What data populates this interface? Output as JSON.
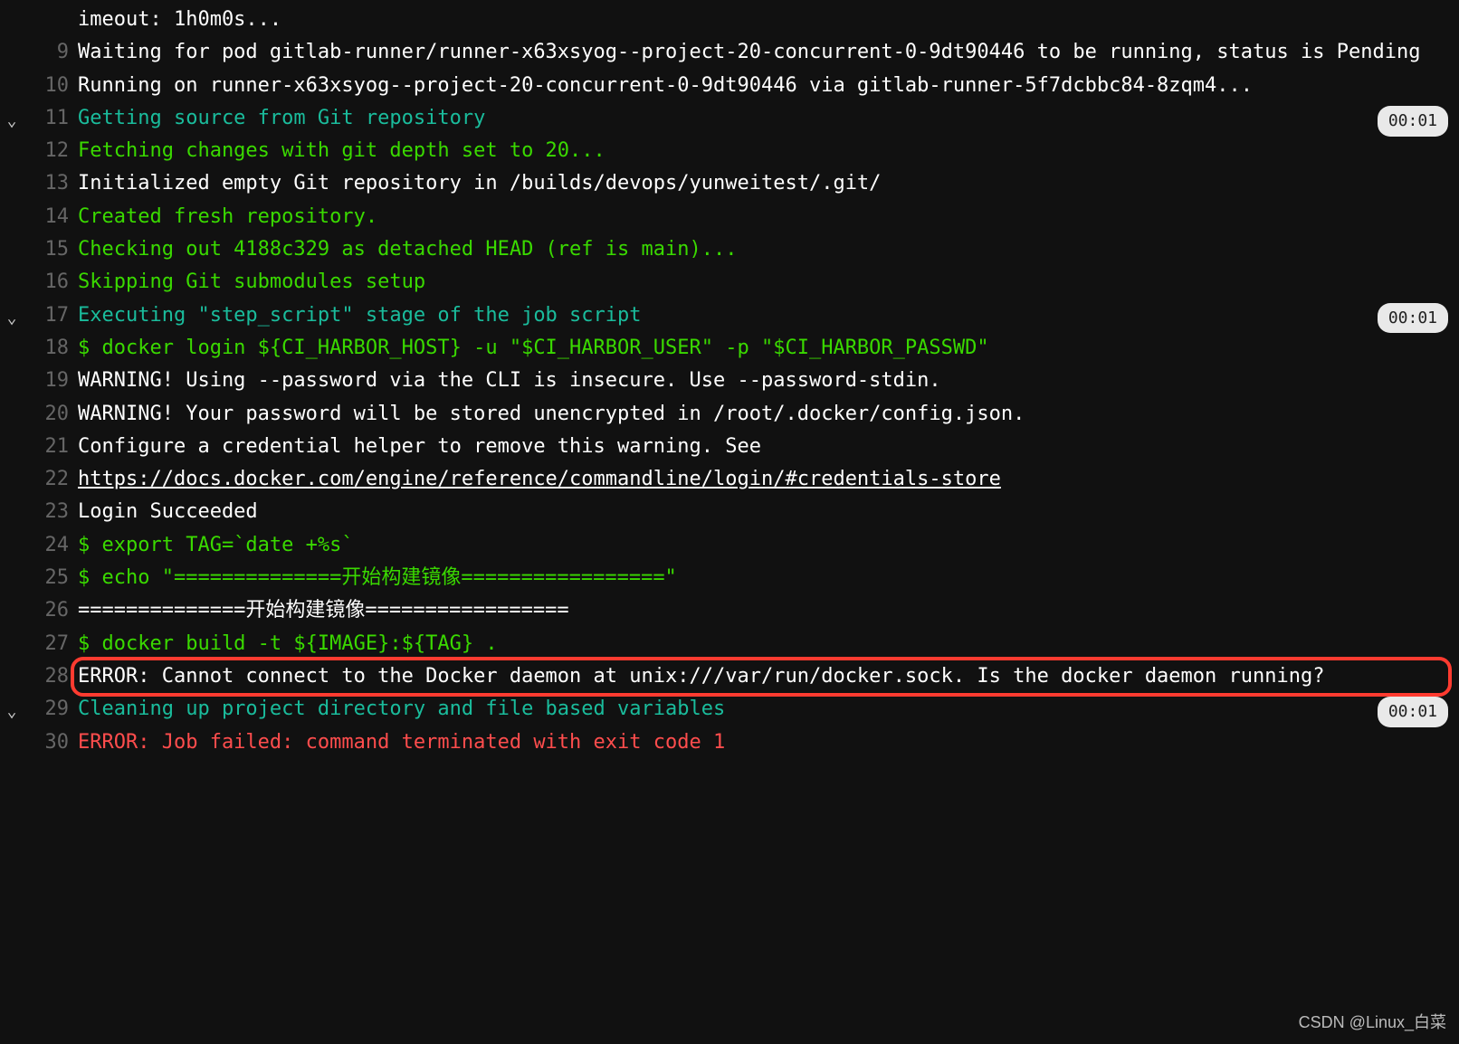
{
  "durations": {
    "git_section": "00:01",
    "script_section": "00:01",
    "cleanup_section": "00:01"
  },
  "watermark": "CSDN @Linux_白菜",
  "lines": [
    {
      "num": "",
      "collapsible": false,
      "color": "white",
      "text": "imeout: 1h0m0s...",
      "duration": null,
      "link": false
    },
    {
      "num": "9",
      "collapsible": false,
      "color": "white",
      "text": "Waiting for pod gitlab-runner/runner-x63xsyog--project-20-concurrent-0-9dt90446 to be running, status is Pending",
      "duration": null,
      "link": false
    },
    {
      "num": "10",
      "collapsible": false,
      "color": "white",
      "text": "Running on runner-x63xsyog--project-20-concurrent-0-9dt90446 via gitlab-runner-5f7dcbbc84-8zqm4...",
      "duration": null,
      "link": false
    },
    {
      "num": "11",
      "collapsible": true,
      "color": "teal",
      "text": "Getting source from Git repository",
      "duration": "git_section",
      "link": false
    },
    {
      "num": "12",
      "collapsible": false,
      "color": "green",
      "text": "Fetching changes with git depth set to 20...",
      "duration": null,
      "link": false
    },
    {
      "num": "13",
      "collapsible": false,
      "color": "white",
      "text": "Initialized empty Git repository in /builds/devops/yunweitest/.git/",
      "duration": null,
      "link": false
    },
    {
      "num": "14",
      "collapsible": false,
      "color": "green",
      "text": "Created fresh repository.",
      "duration": null,
      "link": false
    },
    {
      "num": "15",
      "collapsible": false,
      "color": "green",
      "text": "Checking out 4188c329 as detached HEAD (ref is main)...",
      "duration": null,
      "link": false
    },
    {
      "num": "16",
      "collapsible": false,
      "color": "green",
      "text": "Skipping Git submodules setup",
      "duration": null,
      "link": false
    },
    {
      "num": "17",
      "collapsible": true,
      "color": "teal",
      "text": "Executing \"step_script\" stage of the job script",
      "duration": "script_section",
      "link": false
    },
    {
      "num": "18",
      "collapsible": false,
      "color": "green",
      "text": "$ docker login ${CI_HARBOR_HOST} -u \"$CI_HARBOR_USER\" -p \"$CI_HARBOR_PASSWD\"",
      "duration": null,
      "link": false
    },
    {
      "num": "19",
      "collapsible": false,
      "color": "white",
      "text": "WARNING! Using --password via the CLI is insecure. Use --password-stdin.",
      "duration": null,
      "link": false
    },
    {
      "num": "20",
      "collapsible": false,
      "color": "white",
      "text": "WARNING! Your password will be stored unencrypted in /root/.docker/config.json.",
      "duration": null,
      "link": false
    },
    {
      "num": "21",
      "collapsible": false,
      "color": "white",
      "text": "Configure a credential helper to remove this warning. See",
      "duration": null,
      "link": false
    },
    {
      "num": "22",
      "collapsible": false,
      "color": "white",
      "text": "https://docs.docker.com/engine/reference/commandline/login/#credentials-store",
      "duration": null,
      "link": true
    },
    {
      "num": "23",
      "collapsible": false,
      "color": "white",
      "text": "Login Succeeded",
      "duration": null,
      "link": false
    },
    {
      "num": "24",
      "collapsible": false,
      "color": "green",
      "text": "$ export TAG=`date +%s`",
      "duration": null,
      "link": false
    },
    {
      "num": "25",
      "collapsible": false,
      "color": "green",
      "text": "$ echo \"==============开始构建镜像=================\"",
      "duration": null,
      "link": false
    },
    {
      "num": "26",
      "collapsible": false,
      "color": "white",
      "text": "==============开始构建镜像=================",
      "duration": null,
      "link": false
    },
    {
      "num": "27",
      "collapsible": false,
      "color": "green",
      "text": "$ docker build -t ${IMAGE}:${TAG} .",
      "duration": null,
      "link": false
    },
    {
      "num": "28",
      "collapsible": false,
      "color": "white",
      "text": "ERROR: Cannot connect to the Docker daemon at unix:///var/run/docker.sock. Is the docker daemon running?",
      "duration": null,
      "link": false,
      "highlighted": true
    },
    {
      "num": "29",
      "collapsible": true,
      "color": "teal",
      "text": "Cleaning up project directory and file based variables",
      "duration": "cleanup_section",
      "link": false
    },
    {
      "num": "30",
      "collapsible": false,
      "color": "red",
      "text": "ERROR: Job failed: command terminated with exit code 1",
      "duration": null,
      "link": false
    }
  ]
}
